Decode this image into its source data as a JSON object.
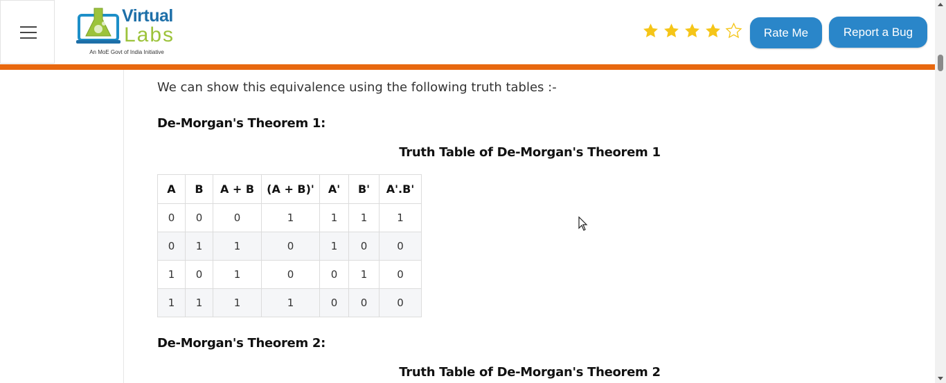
{
  "header": {
    "menu_icon": "hamburger-menu-icon",
    "logo": {
      "word1": "Virtual",
      "word2": "Labs",
      "tagline": "An MoE Govt of India Initiative",
      "colors": {
        "blue": "#1d6fa8",
        "green": "#9cc33b"
      }
    },
    "rating": {
      "filled": 4,
      "total": 5,
      "color": "#f5c518"
    },
    "rate_button": "Rate Me",
    "bug_button": "Report a Bug",
    "accent_color": "#e8680f",
    "button_color": "#2a86c9"
  },
  "content": {
    "intro": "We can show this equivalence using the following truth tables :-",
    "theorem1_heading": "De-Morgan's Theorem 1:",
    "table1_caption": "Truth Table of De-Morgan's Theorem 1",
    "table1": {
      "headers": [
        "A",
        "B",
        "A + B",
        "(A + B)'",
        "A'",
        "B'",
        "A'.B'"
      ],
      "rows": [
        [
          "0",
          "0",
          "0",
          "1",
          "1",
          "1",
          "1"
        ],
        [
          "0",
          "1",
          "1",
          "0",
          "1",
          "0",
          "0"
        ],
        [
          "1",
          "0",
          "1",
          "0",
          "0",
          "1",
          "0"
        ],
        [
          "1",
          "1",
          "1",
          "1",
          "0",
          "0",
          "0"
        ]
      ]
    },
    "theorem2_heading": "De-Morgan's Theorem 2:",
    "table2_caption": "Truth Table of De-Morgan's Theorem 2"
  }
}
